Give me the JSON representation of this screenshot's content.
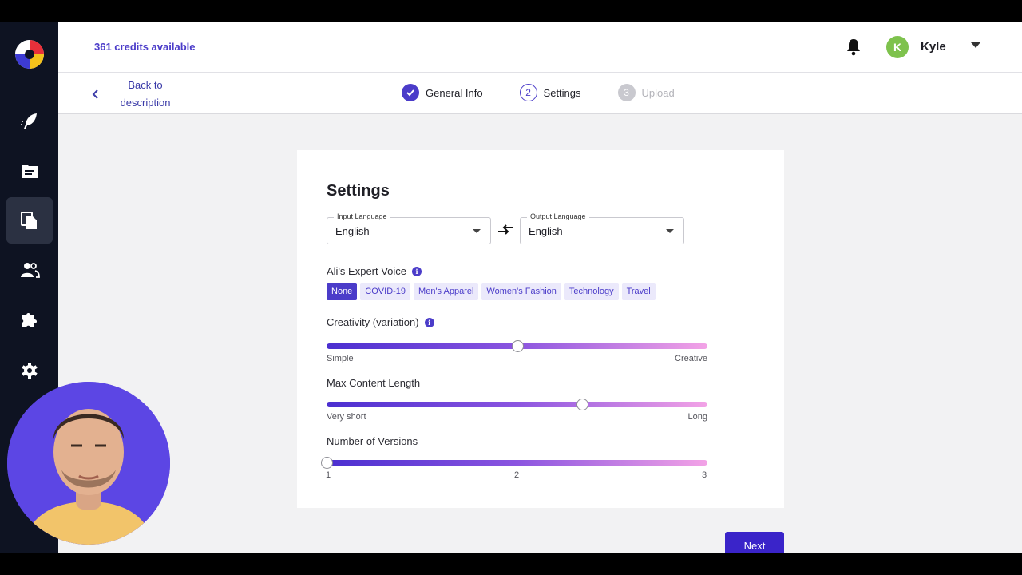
{
  "app": {
    "credits": "361 credits available",
    "user": {
      "initial": "K",
      "name": "Kyle"
    }
  },
  "sidebar": {
    "items": [
      {
        "icon": "feather-icon",
        "active": false
      },
      {
        "icon": "document-icon",
        "active": false
      },
      {
        "icon": "copy-files-icon",
        "active": true
      },
      {
        "icon": "users-icon",
        "active": false
      },
      {
        "icon": "puzzle-icon",
        "active": false
      },
      {
        "icon": "gear-icon",
        "active": false
      }
    ]
  },
  "subbar": {
    "back_line1": "Back to",
    "back_line2": "description",
    "steps": [
      {
        "label": "General Info",
        "status": "done"
      },
      {
        "number": "2",
        "label": "Settings",
        "status": "current"
      },
      {
        "number": "3",
        "label": "Upload",
        "status": "future"
      }
    ]
  },
  "settings": {
    "title": "Settings",
    "input_language": {
      "label": "Input Language",
      "value": "English"
    },
    "output_language": {
      "label": "Output Language",
      "value": "English"
    },
    "expert_voice": {
      "label": "Ali's Expert Voice",
      "options": [
        "None",
        "COVID-19",
        "Men's Apparel",
        "Women's Fashion",
        "Technology",
        "Travel"
      ],
      "selected": "None"
    },
    "creativity": {
      "label": "Creativity (variation)",
      "min_label": "Simple",
      "max_label": "Creative",
      "level": 0.5
    },
    "max_length": {
      "label": "Max Content Length",
      "min_label": "Very short",
      "max_label": "Long",
      "level": 0.67
    },
    "versions": {
      "label": "Number of Versions",
      "ticks": [
        "1",
        "2",
        "3"
      ],
      "value": 1,
      "min": 1,
      "max": 3
    },
    "info_glyph": "i",
    "next_label": "Next"
  },
  "colors": {
    "accent": "#4b3cc9",
    "sidebar_bg": "#0e1322",
    "avatar_green": "#7ec24d"
  }
}
